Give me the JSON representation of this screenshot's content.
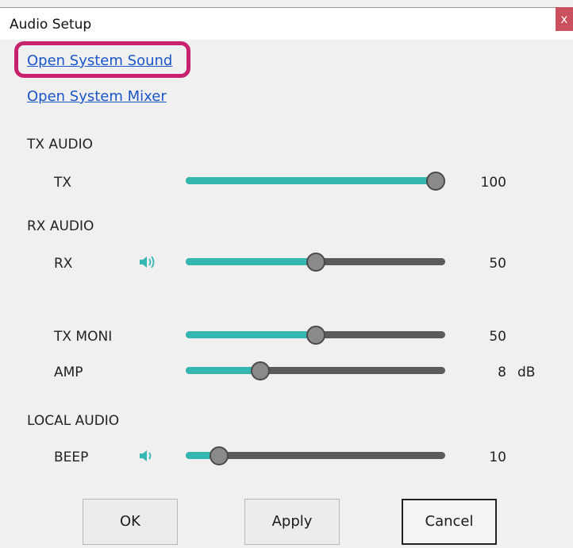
{
  "window": {
    "title": "Audio Setup",
    "close_label": "x"
  },
  "links": {
    "open_system_sound": "Open System Sound",
    "open_system_mixer": "Open System Mixer"
  },
  "colors": {
    "highlight": "#c8226e",
    "slider_fill": "#35b7b1",
    "slider_track": "#5b5b5b",
    "link": "#1a56c9"
  },
  "sections": {
    "tx_audio": "TX AUDIO",
    "rx_audio": "RX AUDIO",
    "local_audio": "LOCAL AUDIO"
  },
  "sliders": {
    "tx": {
      "label": "TX",
      "value": "100",
      "level": 1.0,
      "speaker_icon": ""
    },
    "rx": {
      "label": "RX",
      "value": "50",
      "level": 0.5,
      "speaker_icon": "speaker-icon"
    },
    "tx_moni": {
      "label": "TX MONI",
      "value": "50",
      "level": 0.5,
      "speaker_icon": ""
    },
    "amp": {
      "label": "AMP",
      "value": "8",
      "level": 0.27,
      "unit": "dB",
      "speaker_icon": ""
    },
    "beep": {
      "label": "BEEP",
      "value": "10",
      "level": 0.1,
      "speaker_icon": "speaker-icon"
    }
  },
  "buttons": {
    "ok": "OK",
    "apply": "Apply",
    "cancel": "Cancel"
  }
}
